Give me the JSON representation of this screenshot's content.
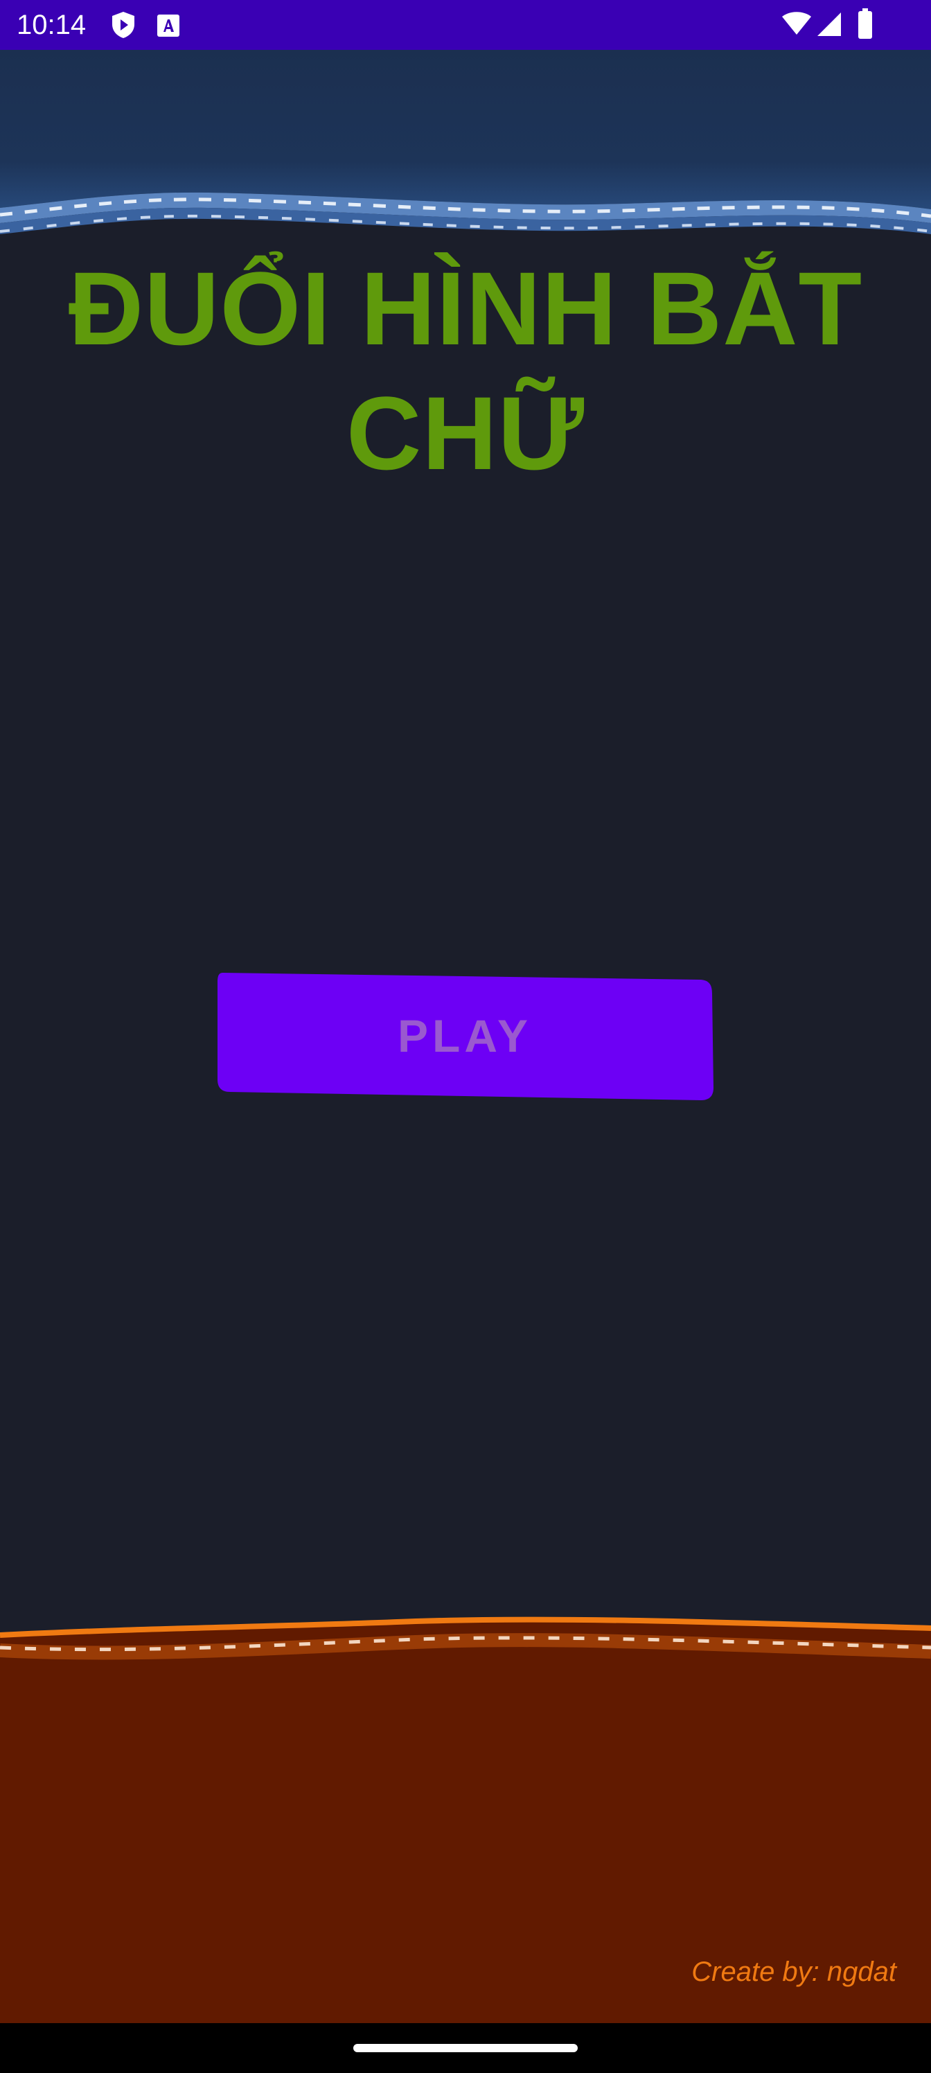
{
  "status_bar": {
    "time": "10:14",
    "background": "#3a00b4",
    "icons_left": [
      "play-protect-icon",
      "keyboard-a-icon"
    ],
    "icons_right": [
      "wifi-icon",
      "signal-icon",
      "battery-icon"
    ]
  },
  "main": {
    "title": "ĐUỔI HÌNH BẮT CHỮ",
    "title_color": "#5f9a0c",
    "play_button": {
      "label": "PLAY",
      "fill_color": "#6d00f5",
      "text_color": "#9a59cf"
    },
    "credit": "Create by: ngdat",
    "credit_color": "#f07a12",
    "background": "#1b1e2a",
    "top_band_color": "#1b2f50",
    "bottom_band_color": "#611a00"
  },
  "nav_bar": {
    "handle": "home-handle"
  }
}
